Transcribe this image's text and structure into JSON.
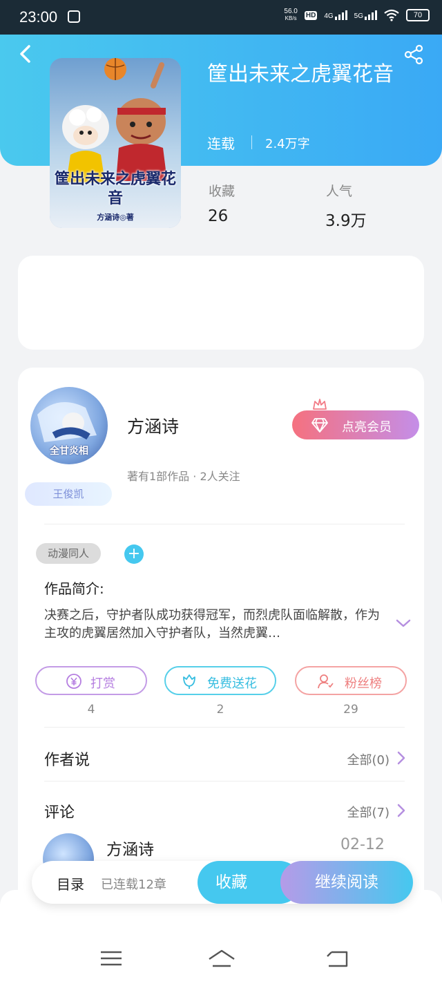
{
  "status_bar": {
    "time": "23:00",
    "net_speed": "56.0",
    "net_unit": "KB/s",
    "hd": "HD",
    "sim1": "4G",
    "sim2": "5G",
    "battery": "70"
  },
  "book": {
    "title": "筐出未来之虎翼花音",
    "status": "连载",
    "word_count": "2.4万字",
    "cover_title": "筐出未来之虎翼花音",
    "cover_author": "方涵诗◎著",
    "stats": [
      {
        "label": "收藏",
        "value": "26"
      },
      {
        "label": "人气",
        "value": "3.9万"
      }
    ]
  },
  "author": {
    "name": "方涵诗",
    "meta": "著有1部作品 · 2人关注",
    "fan_tag": "王俊凯",
    "avatar_text": "全甘炎相",
    "vip_label": "点亮会员"
  },
  "tags": {
    "genre": "动漫同人",
    "add": "+"
  },
  "intro": {
    "label": "作品简介:",
    "text": "决赛之后，守护者队成功获得冠军，而烈虎队面临解散，作为主攻的虎翼居然加入守护者队，当然虎翼…"
  },
  "actions": [
    {
      "label": "打赏",
      "count": "4",
      "icon": "yen-icon"
    },
    {
      "label": "免费送花",
      "count": "2",
      "icon": "flower-icon"
    },
    {
      "label": "粉丝榜",
      "count": "29",
      "icon": "user-icon"
    }
  ],
  "author_says": {
    "title": "作者说",
    "link": "全部(0)"
  },
  "comments": {
    "title": "评论",
    "link": "全部(7)",
    "first": {
      "user": "方涵诗",
      "date": "02-12"
    }
  },
  "bottom_bar": {
    "catalog": "目录",
    "chapters": "已连载12章",
    "collect": "收藏",
    "read": "继续阅读"
  },
  "colors": {
    "header": "#3aa9f5",
    "accent": "#45c8ef",
    "vip": "#f5717f"
  }
}
